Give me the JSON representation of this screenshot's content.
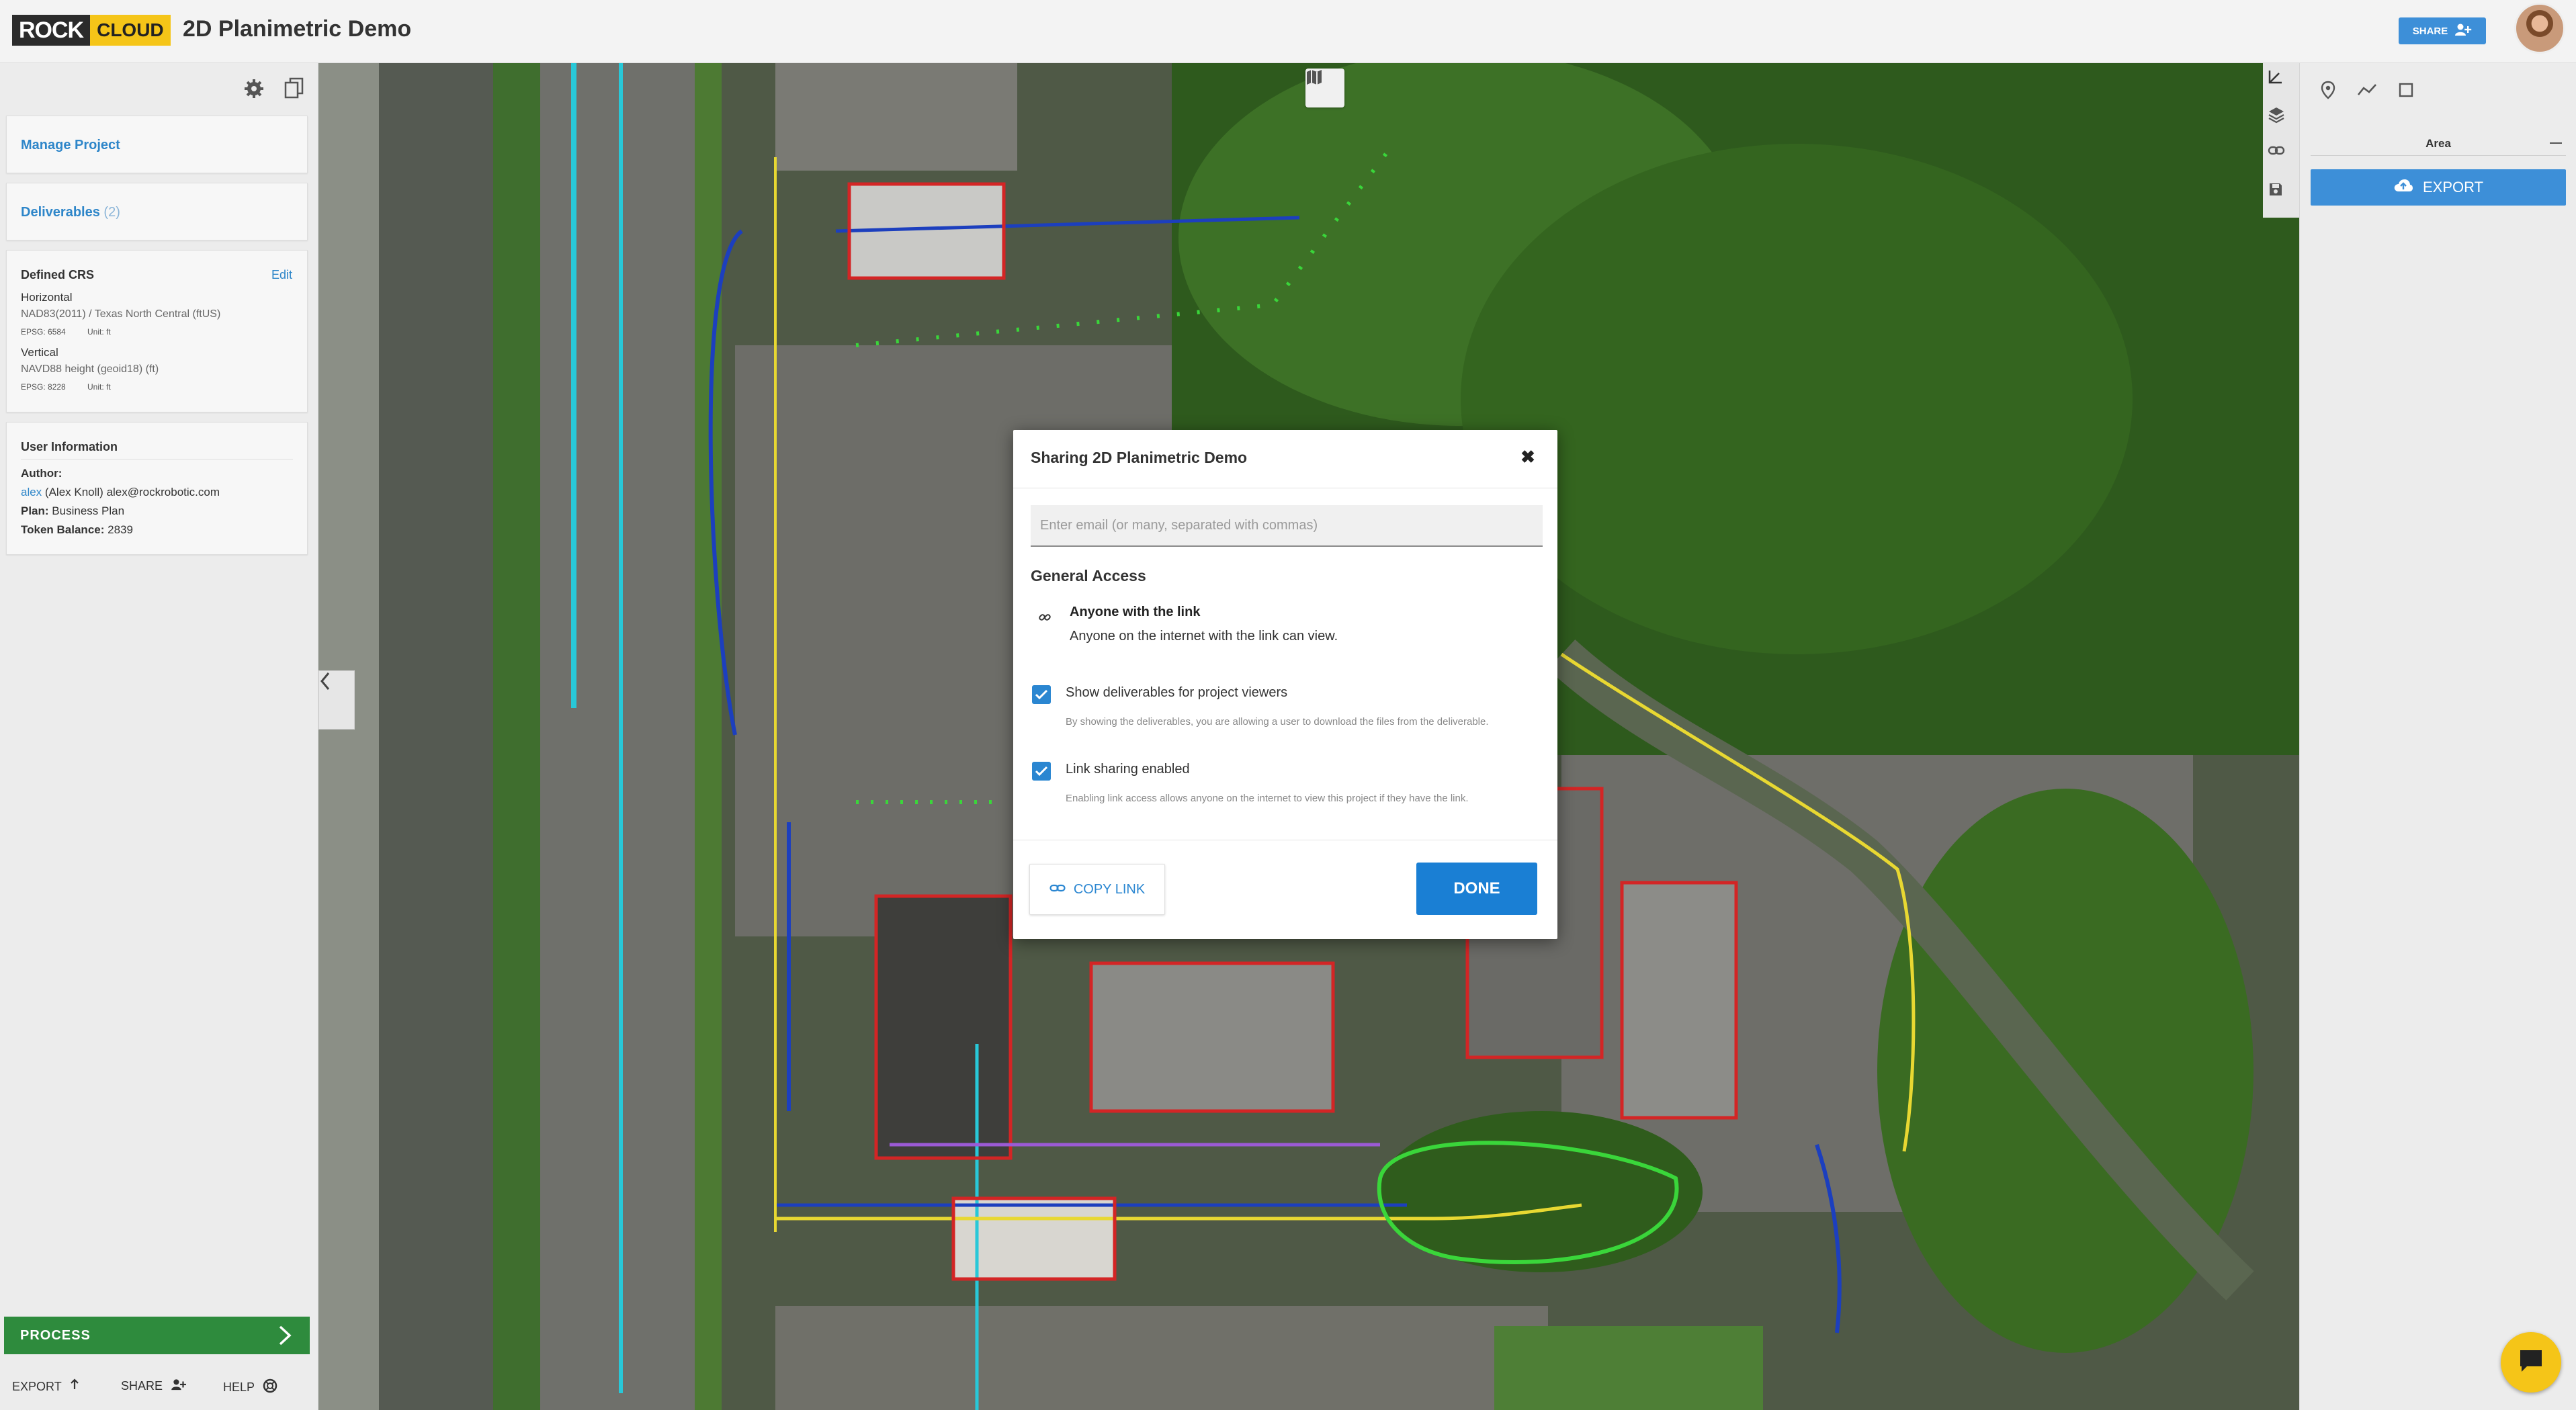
{
  "header": {
    "logo_part1": "ROCK",
    "logo_part2": "CLOUD",
    "title": "2D Planimetric Demo",
    "share_label": "SHARE"
  },
  "sidebar": {
    "manage_project": "Manage Project",
    "deliverables": {
      "label": "Deliverables",
      "count": "(2)"
    },
    "crs": {
      "title": "Defined CRS",
      "edit": "Edit",
      "horizontal_label": "Horizontal",
      "horizontal_value": "NAD83(2011) / Texas North Central (ftUS)",
      "horizontal_epsg": "EPSG: 6584",
      "horizontal_unit": "Unit: ft",
      "vertical_label": "Vertical",
      "vertical_value": "NAVD88 height (geoid18) (ft)",
      "vertical_epsg": "EPSG: 8228",
      "vertical_unit": "Unit: ft"
    },
    "user": {
      "title": "User Information",
      "author_label": "Author:",
      "author_user": "alex",
      "author_detail": "(Alex Knoll) alex@rockrobotic.com",
      "plan_label": "Plan:",
      "plan_value": "Business Plan",
      "token_label": "Token Balance:",
      "token_value": "2839"
    },
    "process_label": "PROCESS",
    "bottom": {
      "export": "EXPORT",
      "share": "SHARE",
      "help": "HELP"
    }
  },
  "right_panel": {
    "area_label": "Area",
    "export_label": "EXPORT"
  },
  "dialog": {
    "title": "Sharing 2D Planimetric Demo",
    "email_placeholder": "Enter email (or many, separated with commas)",
    "general_access": "General Access",
    "anyone_title": "Anyone with the link",
    "anyone_desc": "Anyone on the internet with the link can view.",
    "show_deliverables_label": "Show deliverables for project viewers",
    "show_deliverables_help": "By showing the deliverables, you are allowing a user to download the files from the deliverable.",
    "show_deliverables_checked": true,
    "link_sharing_label": "Link sharing enabled",
    "link_sharing_help": "Enabling link access allows anyone on the internet to view this project if they have the link.",
    "link_sharing_checked": true,
    "copy_link": "COPY LINK",
    "done": "DONE"
  },
  "colors": {
    "accent": "#2a86d1",
    "process_green": "#2e8b3d",
    "brand_yellow": "#f5c518"
  }
}
